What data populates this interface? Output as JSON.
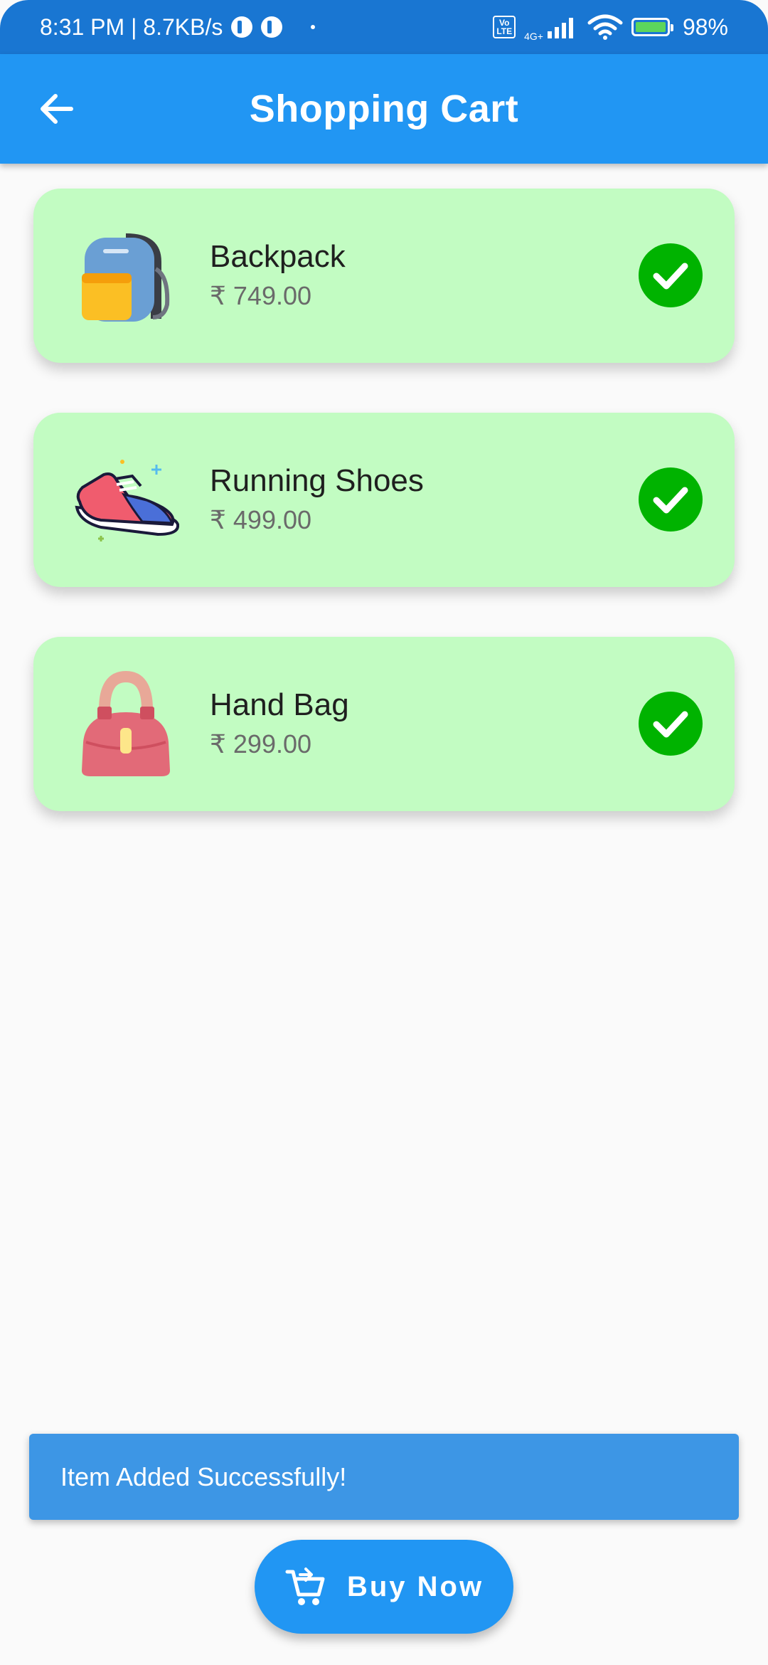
{
  "status_bar": {
    "time_speed": "8:31 PM | 8.7KB/s",
    "volte": "Vo\nLTE",
    "network": "4G+",
    "battery": "98%"
  },
  "app_bar": {
    "title": "Shopping Cart",
    "back_icon": "arrow-back-icon"
  },
  "cart": {
    "items": [
      {
        "name": "Backpack",
        "price": "₹ 749.00",
        "icon": "backpack-icon",
        "selected": true
      },
      {
        "name": "Running Shoes",
        "price": "₹ 499.00",
        "icon": "running-shoe-icon",
        "selected": true
      },
      {
        "name": "Hand Bag",
        "price": "₹ 299.00",
        "icon": "handbag-icon",
        "selected": true
      }
    ]
  },
  "snackbar": {
    "message": "Item Added Successfully!"
  },
  "buy_button": {
    "label": "Buy Now",
    "icon": "add-shopping-cart-icon"
  },
  "colors": {
    "status_bar": "#1976d2",
    "app_bar": "#2196f3",
    "card_background": "#c2fcc2",
    "check_badge": "#00b300",
    "snackbar": "#3d96e5",
    "page_background": "#fafafa"
  }
}
